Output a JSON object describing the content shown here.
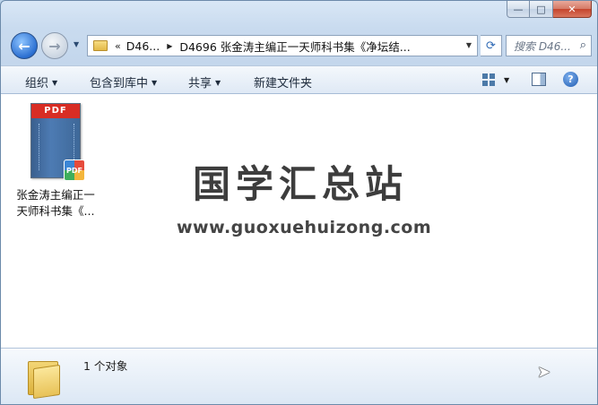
{
  "window": {
    "caption": {
      "minimize": "—",
      "maximize": "□",
      "close": "✕"
    }
  },
  "nav": {
    "back_glyph": "←",
    "forward_glyph": "→",
    "breadcrumb": {
      "overflow": "«",
      "parent": "D46...",
      "current": "D4696 张金涛主编正一天师科书集《净坛结..."
    },
    "search": {
      "placeholder": "搜索 D46..."
    }
  },
  "toolbar": {
    "organize": "组织",
    "include_in_library": "包含到库中",
    "share": "共享",
    "new_folder": "新建文件夹",
    "help": "?"
  },
  "files": [
    {
      "name_line1": "张金涛主编正一",
      "name_line2": "天师科书集《...",
      "thumb_label": "PDF",
      "badge_label": "PDF"
    }
  ],
  "watermark": {
    "title": "国学汇总站",
    "url": "www.guoxuehuizong.com"
  },
  "status": {
    "item_count": "1 个对象"
  }
}
